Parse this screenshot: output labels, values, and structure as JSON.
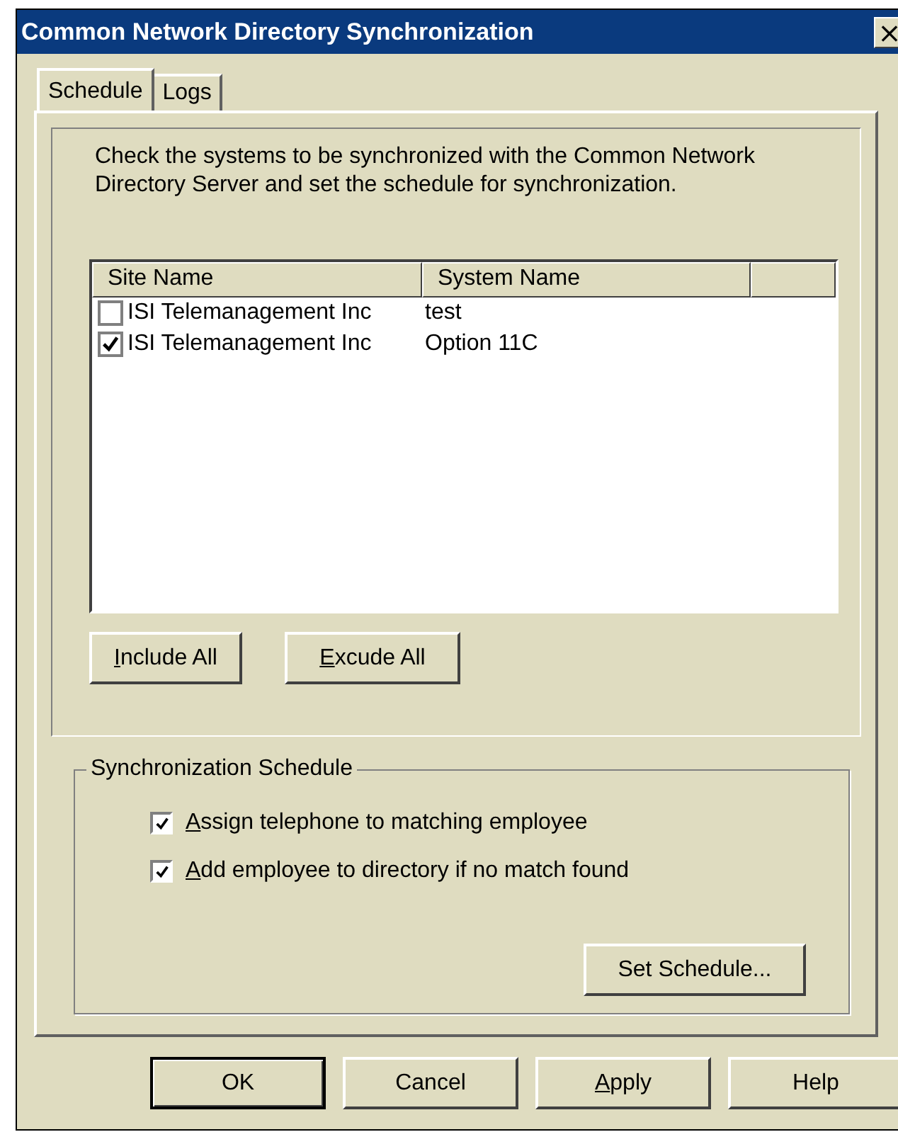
{
  "window": {
    "title": "Common Network Directory Synchronization",
    "close": "×"
  },
  "tabs": [
    {
      "label": "Schedule",
      "selected": true
    },
    {
      "label": "Logs",
      "selected": false
    }
  ],
  "description": "Check the systems to be synchronized with the Common Network Directory Server and set the schedule for synchronization.",
  "table": {
    "columns": [
      "Site Name",
      "System Name"
    ],
    "rows": [
      {
        "site": "ISI Telemanagement Inc",
        "system": "test",
        "checked": false
      },
      {
        "site": "ISI Telemanagement Inc",
        "system": "Option 11C",
        "checked": true
      }
    ]
  },
  "list_buttons": [
    {
      "label": "Include All",
      "accel": true
    },
    {
      "label": "Excude All",
      "accel": true
    }
  ],
  "schedule_group": {
    "title": "Synchronization Schedule",
    "options": [
      {
        "label": "Assign telephone to matching employee",
        "checked": true,
        "accel": true
      },
      {
        "label": "Add employee to directory if no match found",
        "checked": true,
        "accel": true
      }
    ],
    "button": "Set Schedule..."
  },
  "buttons": [
    {
      "label": "OK",
      "accel": false,
      "default": true
    },
    {
      "label": "Cancel",
      "accel": false,
      "default": false
    },
    {
      "label": "Apply",
      "accel": true,
      "default": false
    },
    {
      "label": "Help",
      "accel": false,
      "default": false
    }
  ]
}
